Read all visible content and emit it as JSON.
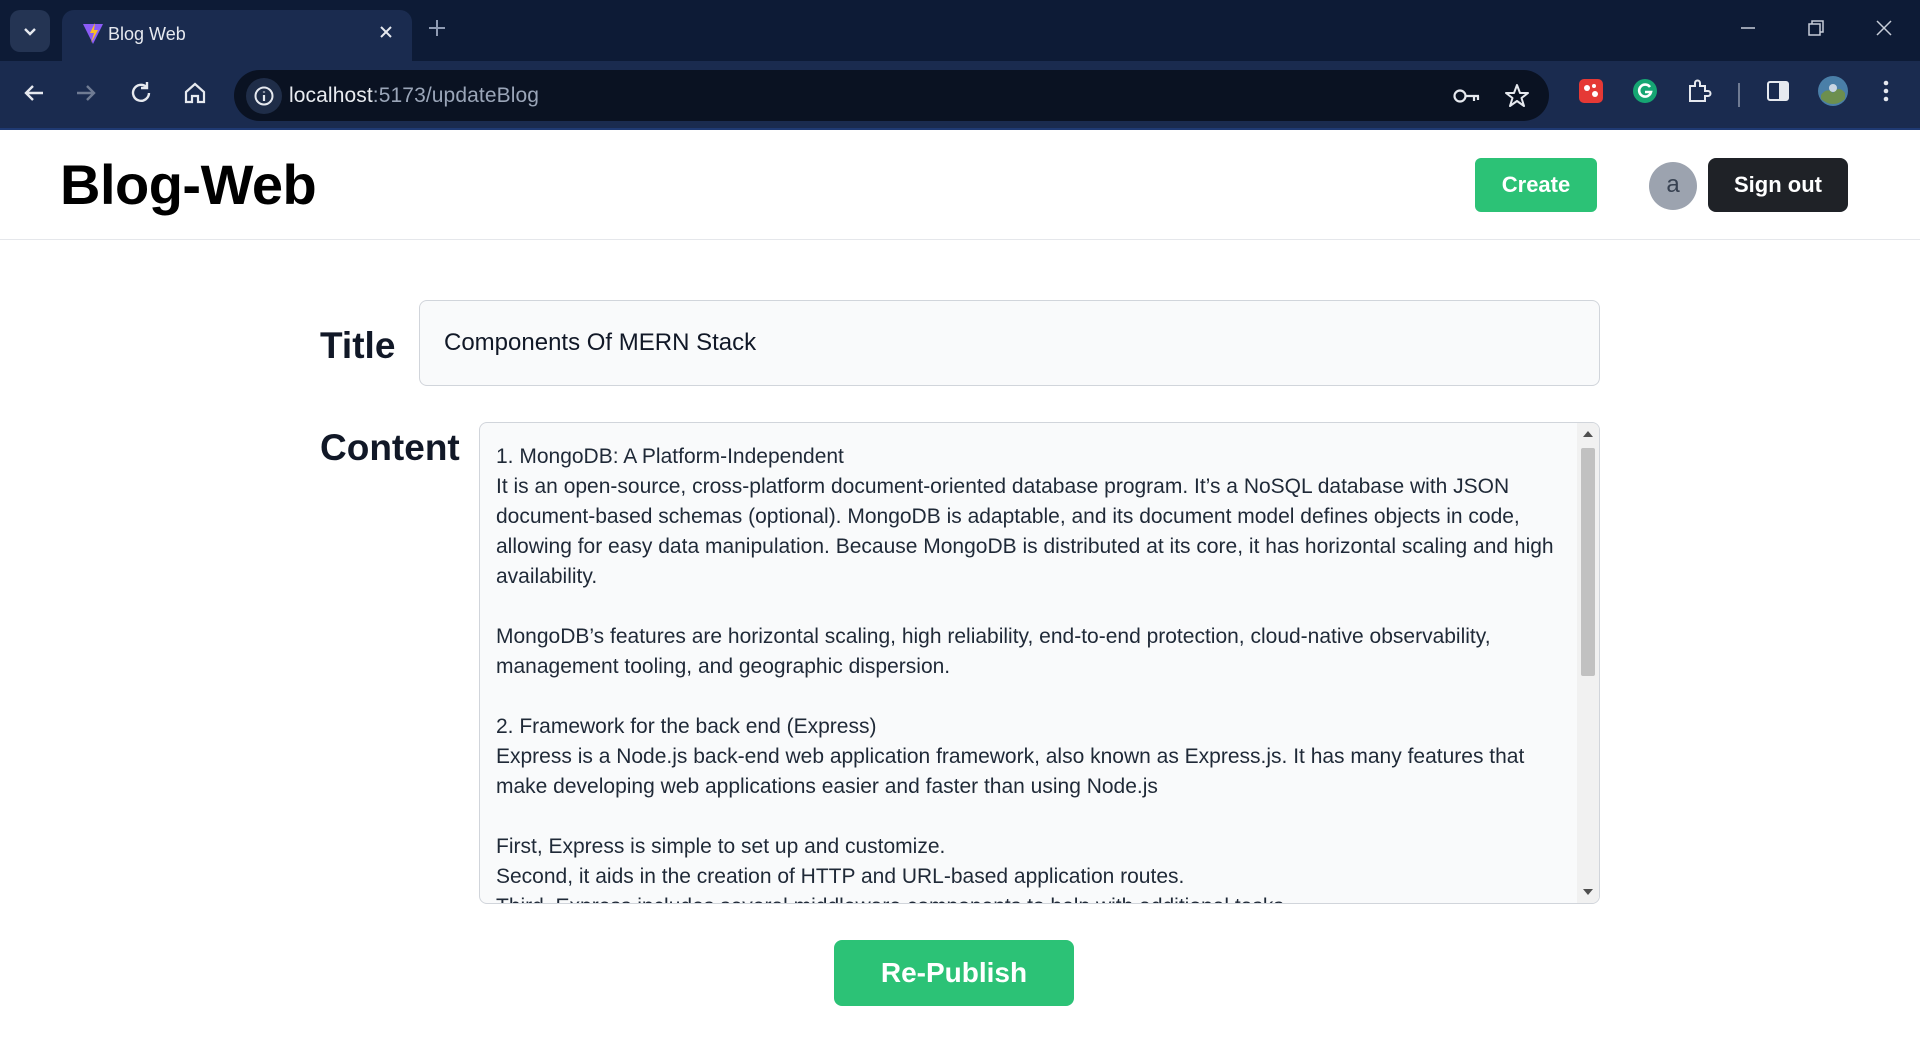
{
  "browser": {
    "tab": {
      "title": "Blog Web"
    },
    "url": {
      "host": "localhost",
      "path": ":5173/updateBlog"
    }
  },
  "navbar": {
    "brand": "Blog-Web",
    "create_label": "Create",
    "avatar_initial": "a",
    "signout_label": "Sign out"
  },
  "form": {
    "title_label": "Title",
    "title_value": "Components Of MERN Stack",
    "content_label": "Content",
    "content_value": "1. MongoDB: A Platform-Independent\nIt is an open-source, cross-platform document-oriented database program. It’s a NoSQL database with JSON document-based schemas (optional). MongoDB is adaptable, and its document model defines objects in code, allowing for easy data manipulation. Because MongoDB is distributed at its core, it has horizontal scaling and high availability.\n\nMongoDB’s features are horizontal scaling, high reliability, end-to-end protection, cloud-native observability, management tooling, and geographic dispersion.\n\n2. Framework for the back end (Express)\nExpress is a Node.js back-end web application framework, also known as Express.js. It has many features that make developing web applications easier and faster than using Node.js\n\nFirst, Express is simple to set up and customize.\nSecond, it aids in the creation of HTTP and URL-based application routes.\nThird, Express includes several middleware components to help with additional tasks.",
    "submit_label": "Re-Publish"
  },
  "colors": {
    "accent_green": "#2cc276",
    "signout_dark": "#1f2227",
    "chrome_dark": "#0d1b36"
  }
}
